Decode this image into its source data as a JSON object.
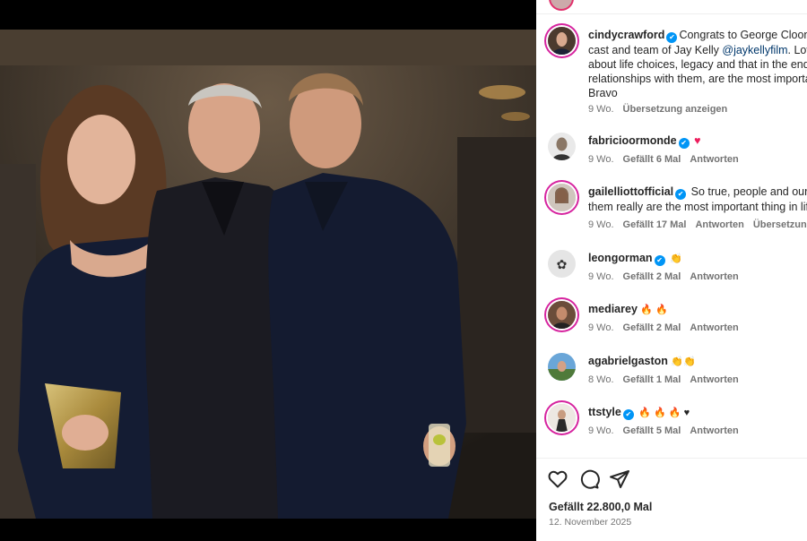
{
  "photo": {
    "alt": "Cindy Crawford, George Clooney and Rande Gerber posing at an evening event"
  },
  "comments": [
    {
      "username": "cindycrawford",
      "verified": true,
      "lines": [
        "Congrats to George Clooney",
        "cast and team of Jay Kelly ",
        "about life choices, legacy and that in the end,",
        "relationships with them, are the most importa",
        "Bravo"
      ],
      "mention": "@jaykellyfilm",
      "line2_after": ". Loved",
      "time": "9 Wo.",
      "translate": "Übersetzung anzeigen"
    },
    {
      "username": "fabricioormonde",
      "verified": true,
      "text": "",
      "emoji": "♥",
      "time": "9 Wo.",
      "likes": "Gefällt 6 Mal",
      "reply": "Antworten"
    },
    {
      "username": "gailelliottofficial",
      "verified": true,
      "text": "So true, people and our re",
      "line2": "them really are the most important thing in lif",
      "time": "9 Wo.",
      "likes": "Gefällt 17 Mal",
      "reply": "Antworten",
      "translate": "Übersetzung an"
    },
    {
      "username": "leongorman",
      "verified": true,
      "emoji": "👏",
      "time": "9 Wo.",
      "likes": "Gefällt 2 Mal",
      "reply": "Antworten"
    },
    {
      "username": "mediarey",
      "verified": false,
      "emoji": "🔥 🔥",
      "time": "9 Wo.",
      "likes": "Gefällt 2 Mal",
      "reply": "Antworten"
    },
    {
      "username": "agabrielgaston",
      "verified": false,
      "emoji": "👏👏",
      "time": "8 Wo.",
      "likes": "Gefällt 1 Mal",
      "reply": "Antworten"
    },
    {
      "username": "ttstyle",
      "verified": true,
      "emoji": "🔥 🔥 🔥 ♥",
      "time": "9 Wo.",
      "likes": "Gefällt 5 Mal",
      "reply": "Antworten"
    }
  ],
  "post": {
    "likes": "Gefällt 22.800,0 Mal",
    "date": "12. November 2025"
  },
  "icons": {
    "like": "heart-icon",
    "comment": "comment-icon",
    "share": "share-icon",
    "verified": "verified-badge-icon"
  },
  "colors": {
    "verified": "#0095f6",
    "mention": "#00376b",
    "story_ring": "#d6249f",
    "heart": "#ed1c5c"
  }
}
